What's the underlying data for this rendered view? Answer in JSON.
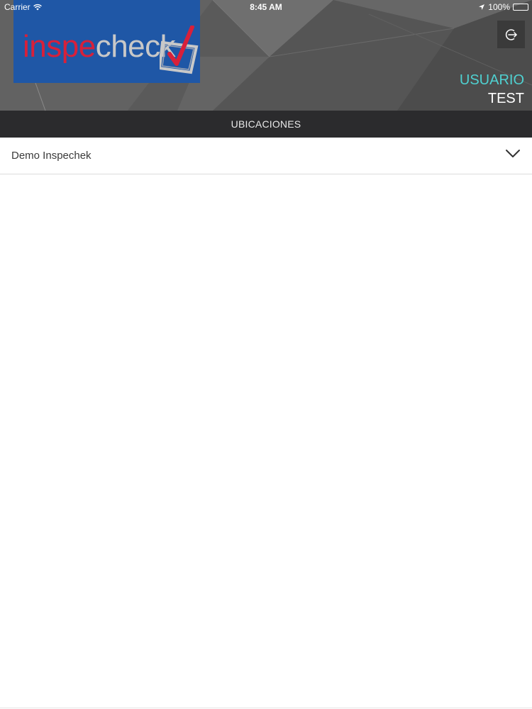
{
  "status_bar": {
    "carrier": "Carrier",
    "time": "8:45 AM",
    "battery": "100%",
    "icons": [
      "wifi-icon",
      "location-arrow-icon",
      "battery-icon"
    ]
  },
  "header": {
    "logo": {
      "part1": "inspe",
      "part2": "check",
      "brand_color": "#1f57a6",
      "accent_color": "#d8203a"
    },
    "logout_icon": "logout-icon",
    "user": {
      "line1": "USUARIO",
      "line2": "TEST",
      "line1_color": "#4fd1d1"
    }
  },
  "section": {
    "title": "UBICACIONES"
  },
  "locations": [
    {
      "label": "Demo Inspechek",
      "icon": "chevron-down-icon"
    }
  ]
}
